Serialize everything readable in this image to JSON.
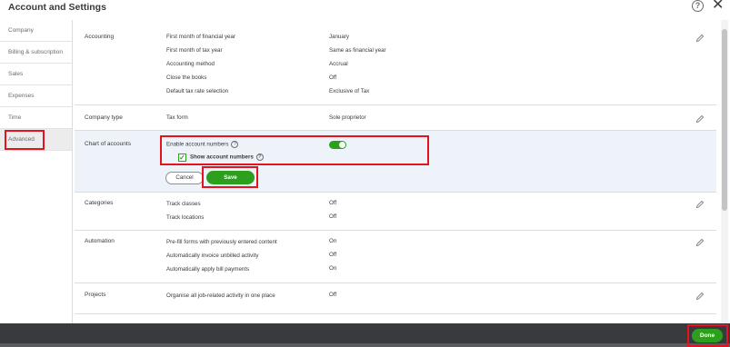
{
  "header": {
    "title": "Account and Settings",
    "help_symbol": "?",
    "close_symbol": "✕"
  },
  "sidebar": {
    "items": [
      {
        "label": "Company"
      },
      {
        "label": "Billing & subscription"
      },
      {
        "label": "Sales"
      },
      {
        "label": "Expenses"
      },
      {
        "label": "Time"
      },
      {
        "label": "Advanced",
        "active": true
      }
    ]
  },
  "sections": {
    "accounting": {
      "label": "Accounting",
      "rows": [
        {
          "label": "First month of financial year",
          "value": "January"
        },
        {
          "label": "First month of tax year",
          "value": "Same as financial year"
        },
        {
          "label": "Accounting method",
          "value": "Accrual"
        },
        {
          "label": "Close the books",
          "value": "Off"
        },
        {
          "label": "Default tax rate selection",
          "value": "Exclusive of Tax"
        }
      ]
    },
    "company_type": {
      "label": "Company type",
      "rows": [
        {
          "label": "Tax form",
          "value": "Sole proprietor"
        }
      ]
    },
    "chart_of_accounts": {
      "label": "Chart of accounts",
      "enable_label": "Enable account numbers",
      "enable_on": true,
      "show_label": "Show account numbers",
      "show_checked": true,
      "cancel_label": "Cancel",
      "save_label": "Save"
    },
    "categories": {
      "label": "Categories",
      "rows": [
        {
          "label": "Track classes",
          "value": "Off"
        },
        {
          "label": "Track locations",
          "value": "Off"
        }
      ]
    },
    "automation": {
      "label": "Automation",
      "rows": [
        {
          "label": "Pre-fill forms with previously entered content",
          "value": "On"
        },
        {
          "label": "Automatically invoice unbilled activity",
          "value": "Off"
        },
        {
          "label": "Automatically apply bill payments",
          "value": "On"
        }
      ]
    },
    "projects": {
      "label": "Projects",
      "rows": [
        {
          "label": "Organise all job-related activity in one place",
          "value": "Off"
        }
      ]
    }
  },
  "footer": {
    "done_label": "Done"
  },
  "colors": {
    "accent_green": "#2ca01c",
    "highlight_red": "#e5121f",
    "footer_bg": "#393a3d"
  },
  "icons": {
    "edit": "pencil-icon",
    "info": "info-icon",
    "help": "help-icon",
    "close": "close-icon"
  }
}
